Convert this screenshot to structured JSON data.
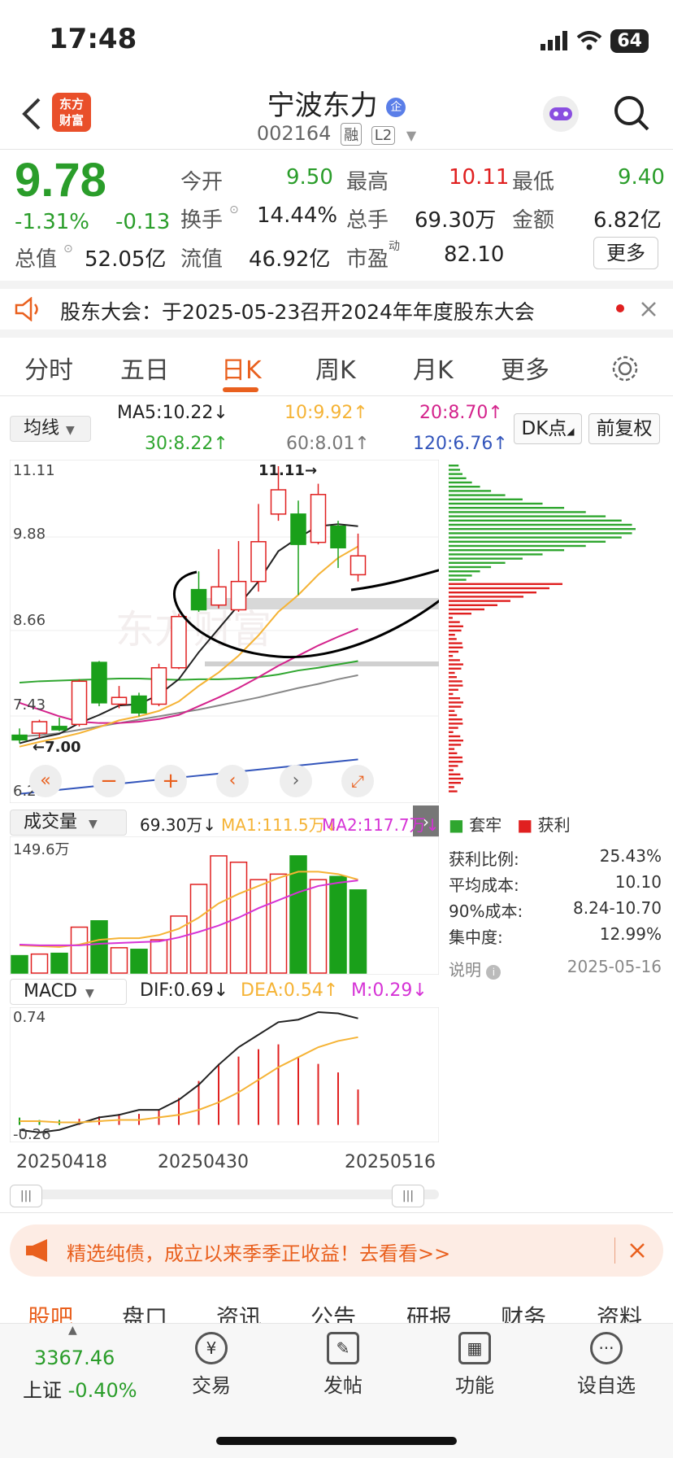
{
  "status": {
    "time": "17:48",
    "battery": "64"
  },
  "header": {
    "logo_line1": "东方",
    "logo_line2": "财富",
    "title": "宁波东力",
    "badge": "企",
    "code": "002164",
    "tag1": "融",
    "tag2": "L2"
  },
  "quote": {
    "price": "9.78",
    "change_pct": "-1.31%",
    "change": "-0.13",
    "open_label": "今开",
    "open": "9.50",
    "high_label": "最高",
    "high": "10.11",
    "low_label": "最低",
    "low": "9.40",
    "turnover_label": "换手",
    "turnover": "14.44%",
    "volume_label": "总手",
    "volume": "69.30万",
    "amount_label": "金额",
    "amount": "6.82亿",
    "mktcap_label": "总值",
    "mktcap": "52.05亿",
    "float_label": "流值",
    "float": "46.92亿",
    "pe_label": "市盈",
    "pe_sup": "动",
    "pe": "82.10",
    "more_label": "更多"
  },
  "notice": {
    "text": "股东大会：于2025-05-23召开2024年年度股东大会"
  },
  "tabs": {
    "t1": "分时",
    "t2": "五日",
    "t3": "日K",
    "t4": "周K",
    "t5": "月K",
    "t6": "更多"
  },
  "ma": {
    "select": "均线",
    "ma5": "MA5:10.22↓",
    "ma10": "10:9.92↑",
    "ma20": "20:8.70↑",
    "ma30": "30:8.22↑",
    "ma60": "60:8.01↑",
    "ma120": "120:6.76↑",
    "dk": "DK点",
    "fq": "前复权"
  },
  "colors": {
    "up": "#e02020",
    "down": "#1aa01a",
    "ma5": "#222222",
    "ma10": "#f5b335",
    "ma20": "#d4238c",
    "ma30": "#2fa62f",
    "ma60": "#888888",
    "ma120": "#3355bb",
    "accent": "#e9601e"
  },
  "kline_axis": {
    "p1": "11.11",
    "p2": "9.88",
    "p3": "8.66",
    "p4": "7.43",
    "p5": "6.21",
    "hi_mark": "11.11",
    "lo_mark": "7.00",
    "watermark": "东方财富"
  },
  "chart_data": [
    {
      "type": "candlestick",
      "y_ticks": [
        11.11,
        9.88,
        8.66,
        7.43,
        6.21
      ],
      "ylim": [
        6.21,
        11.11
      ],
      "candles": [
        {
          "o": 7.12,
          "c": 7.05,
          "h": 7.22,
          "l": 7.0
        },
        {
          "o": 7.15,
          "c": 7.32,
          "h": 7.35,
          "l": 7.08
        },
        {
          "o": 7.25,
          "c": 7.2,
          "h": 7.38,
          "l": 7.18
        },
        {
          "o": 7.28,
          "c": 7.92,
          "h": 7.95,
          "l": 7.25
        },
        {
          "o": 8.2,
          "c": 7.6,
          "h": 8.22,
          "l": 7.55
        },
        {
          "o": 7.58,
          "c": 7.68,
          "h": 7.85,
          "l": 7.52
        },
        {
          "o": 7.7,
          "c": 7.45,
          "h": 7.75,
          "l": 7.4
        },
        {
          "o": 7.58,
          "c": 8.12,
          "h": 8.18,
          "l": 7.55
        },
        {
          "o": 8.12,
          "c": 8.88,
          "h": 8.92,
          "l": 8.1
        },
        {
          "o": 9.28,
          "c": 8.98,
          "h": 9.55,
          "l": 8.95
        },
        {
          "o": 9.05,
          "c": 9.32,
          "h": 9.88,
          "l": 9.0
        },
        {
          "o": 8.98,
          "c": 9.4,
          "h": 10.0,
          "l": 8.95
        },
        {
          "o": 9.4,
          "c": 9.99,
          "h": 10.55,
          "l": 9.25
        },
        {
          "o": 10.4,
          "c": 10.76,
          "h": 11.11,
          "l": 10.3
        },
        {
          "o": 10.4,
          "c": 9.95,
          "h": 10.6,
          "l": 9.2
        },
        {
          "o": 9.98,
          "c": 10.69,
          "h": 10.85,
          "l": 9.95
        },
        {
          "o": 10.22,
          "c": 9.9,
          "h": 10.3,
          "l": 9.6
        },
        {
          "o": 9.5,
          "c": 9.78,
          "h": 10.11,
          "l": 9.4
        }
      ],
      "ma5": [
        7.0,
        7.08,
        7.14,
        7.3,
        7.42,
        7.56,
        7.58,
        7.72,
        7.95,
        8.35,
        8.7,
        9.05,
        9.4,
        9.85,
        10.05,
        10.22,
        10.25,
        10.22
      ],
      "ma10": [
        6.95,
        7.02,
        7.08,
        7.15,
        7.24,
        7.34,
        7.4,
        7.48,
        7.62,
        7.85,
        8.05,
        8.3,
        8.6,
        8.95,
        9.2,
        9.5,
        9.75,
        9.92
      ],
      "ma20": [
        7.6,
        7.5,
        7.4,
        7.32,
        7.3,
        7.3,
        7.32,
        7.36,
        7.42,
        7.55,
        7.68,
        7.82,
        7.98,
        8.15,
        8.3,
        8.45,
        8.58,
        8.7
      ],
      "ma30": [
        7.9,
        7.92,
        7.93,
        7.94,
        7.95,
        7.96,
        7.96,
        7.95,
        7.94,
        7.95,
        7.95,
        7.96,
        7.98,
        8.02,
        8.08,
        8.12,
        8.17,
        8.22
      ],
      "ma60": [
        7.1,
        7.12,
        7.15,
        7.2,
        7.25,
        7.3,
        7.35,
        7.4,
        7.45,
        7.5,
        7.56,
        7.62,
        7.68,
        7.75,
        7.82,
        7.88,
        7.95,
        8.01
      ],
      "ma120": [
        6.25,
        6.28,
        6.31,
        6.34,
        6.37,
        6.4,
        6.43,
        6.46,
        6.49,
        6.52,
        6.55,
        6.58,
        6.61,
        6.64,
        6.67,
        6.7,
        6.73,
        6.76
      ]
    },
    {
      "type": "bar",
      "name": "成交量",
      "ymax_label": "149.6万",
      "values": [
        22,
        24,
        25,
        58,
        66,
        32,
        30,
        42,
        72,
        112,
        148,
        140,
        118,
        125,
        148,
        118,
        122,
        105,
        69.3
      ],
      "up": [
        false,
        true,
        false,
        true,
        false,
        true,
        false,
        true,
        true,
        true,
        true,
        true,
        true,
        true,
        false,
        true,
        false,
        false
      ],
      "ma1": [
        35,
        34,
        33,
        36,
        42,
        44,
        44,
        48,
        56,
        70,
        88,
        100,
        110,
        120,
        128,
        128,
        125,
        118
      ],
      "ma2": [
        36,
        35,
        35,
        35,
        37,
        38,
        39,
        40,
        45,
        52,
        60,
        70,
        82,
        92,
        102,
        110,
        114,
        117
      ]
    },
    {
      "type": "bar",
      "name": "MACD",
      "hist": [
        0.06,
        0.04,
        0.04,
        0.05,
        0.07,
        0.09,
        0.09,
        0.12,
        0.22,
        0.36,
        0.5,
        0.56,
        0.62,
        0.66,
        0.56,
        0.5,
        0.43,
        0.29
      ],
      "dif": [
        -0.2,
        -0.22,
        -0.2,
        -0.15,
        -0.1,
        -0.08,
        -0.04,
        -0.04,
        0.04,
        0.16,
        0.32,
        0.46,
        0.56,
        0.66,
        0.68,
        0.74,
        0.73,
        0.69
      ],
      "dea": [
        -0.13,
        -0.13,
        -0.14,
        -0.14,
        -0.13,
        -0.12,
        -0.12,
        -0.1,
        -0.08,
        -0.04,
        0.02,
        0.1,
        0.2,
        0.3,
        0.38,
        0.46,
        0.51,
        0.54
      ],
      "ylim": [
        -0.26,
        0.74
      ]
    }
  ],
  "vol": {
    "select": "成交量",
    "v": "69.30万↓",
    "ma1": "MA1:111.5万↓",
    "ma2": "MA2:117.7万↓",
    "max": "149.6万"
  },
  "macd": {
    "select": "MACD",
    "dif": "DIF:0.69↓",
    "dea": "DEA:0.54↑",
    "m": "M:0.29↓",
    "top": "0.74",
    "bottom": "-0.26"
  },
  "dates": {
    "d1": "20250418",
    "d2": "20250430",
    "d3": "20250516"
  },
  "chip": {
    "legend_trapped": "套牢",
    "legend_profit": "获利",
    "r1l": "获利比例:",
    "r1v": "25.43%",
    "r2l": "平均成本:",
    "r2v": "10.10",
    "r3l": "90%成本:",
    "r3v": "8.24-10.70",
    "r4l": "集中度:",
    "r4v": "12.99%",
    "r5l": "说明",
    "r5v": "2025-05-16"
  },
  "banner": {
    "text": "精选纯债，成立以来季季正收益！去看看>>"
  },
  "bottom_tabs": {
    "b1": "股吧",
    "b2": "盘口",
    "b3": "资讯",
    "b4": "公告",
    "b5": "研报",
    "b6": "财务",
    "b7": "资料"
  },
  "nav": {
    "index_value": "3367.46",
    "index_name": "上证",
    "index_change": "-0.40%",
    "n1": "交易",
    "n2": "发帖",
    "n3": "功能",
    "n4": "设自选"
  }
}
